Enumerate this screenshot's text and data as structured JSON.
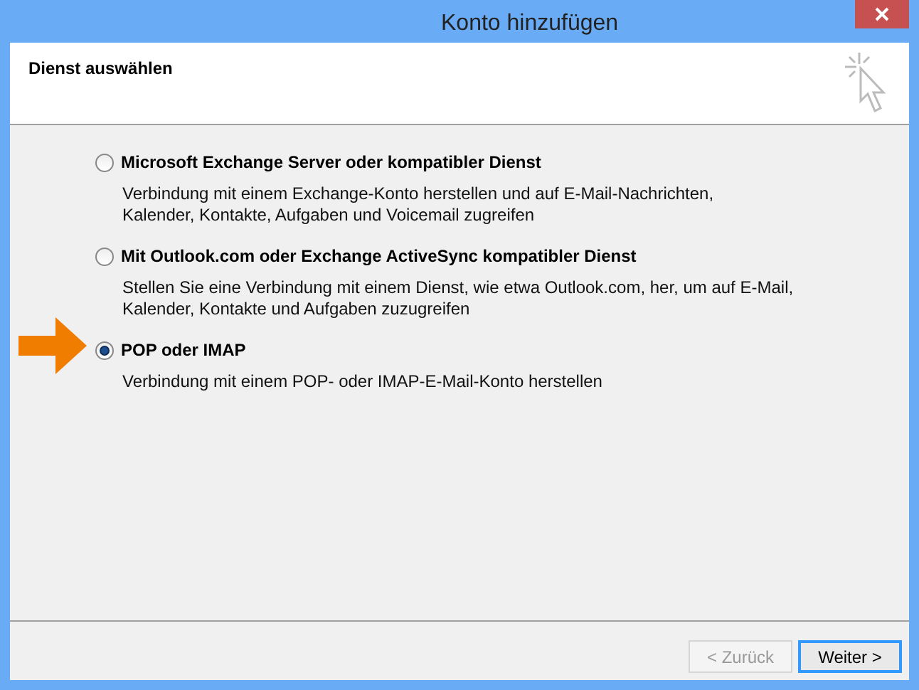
{
  "window": {
    "title": "Konto hinzufügen"
  },
  "header": {
    "title": "Dienst auswählen"
  },
  "options": [
    {
      "label": "Microsoft Exchange Server oder kompatibler Dienst",
      "description_lines": [
        "Verbindung mit einem Exchange-Konto herstellen und auf E-Mail-Nachrichten,",
        "Kalender, Kontakte, Aufgaben und Voicemail zugreifen"
      ],
      "selected": false,
      "pointed": false
    },
    {
      "label": "Mit Outlook.com oder Exchange ActiveSync kompatibler Dienst",
      "description_lines": [
        "Stellen Sie eine Verbindung mit einem Dienst, wie etwa Outlook.com, her, um auf E-Mail,",
        "Kalender, Kontakte und Aufgaben zuzugreifen"
      ],
      "selected": false,
      "pointed": false
    },
    {
      "label": "POP oder IMAP",
      "description_lines": [
        "Verbindung mit einem POP- oder IMAP-E-Mail-Konto herstellen"
      ],
      "selected": true,
      "pointed": true
    }
  ],
  "buttons": [
    {
      "label": "< Zurück",
      "disabled": true,
      "default": false
    },
    {
      "label": "Weiter >",
      "disabled": false,
      "default": true
    }
  ]
}
